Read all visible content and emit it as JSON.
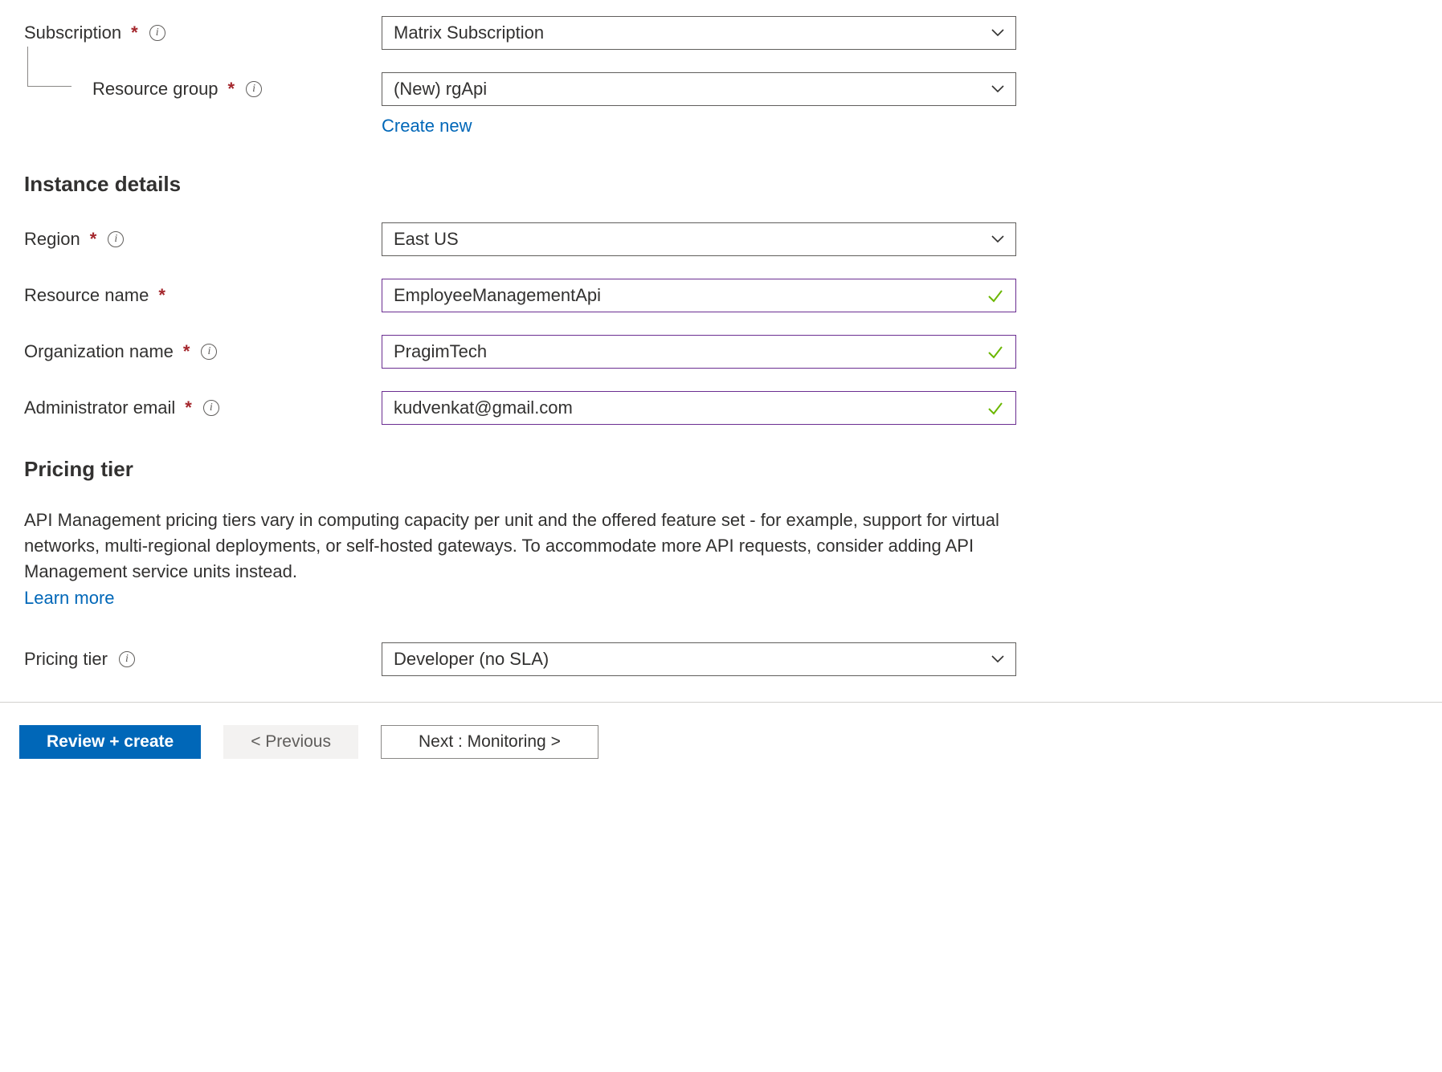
{
  "project": {
    "subscription": {
      "label": "Subscription",
      "value": "Matrix Subscription"
    },
    "resourceGroup": {
      "label": "Resource group",
      "value": "(New) rgApi",
      "createNew": "Create new"
    }
  },
  "instance": {
    "heading": "Instance details",
    "region": {
      "label": "Region",
      "value": "East US"
    },
    "resourceName": {
      "label": "Resource name",
      "value": "EmployeeManagementApi"
    },
    "orgName": {
      "label": "Organization name",
      "value": "PragimTech"
    },
    "adminEmail": {
      "label": "Administrator email",
      "value": "kudvenkat@gmail.com"
    }
  },
  "pricing": {
    "heading": "Pricing tier",
    "description": "API Management pricing tiers vary in computing capacity per unit and the offered feature set - for example, support for virtual networks, multi-regional deployments, or self-hosted gateways. To accommodate more API requests, consider adding API Management service units instead.",
    "learnMore": "Learn more",
    "tier": {
      "label": "Pricing tier",
      "value": "Developer (no SLA)"
    }
  },
  "footer": {
    "reviewCreate": "Review + create",
    "previous": "< Previous",
    "next": "Next : Monitoring >"
  }
}
